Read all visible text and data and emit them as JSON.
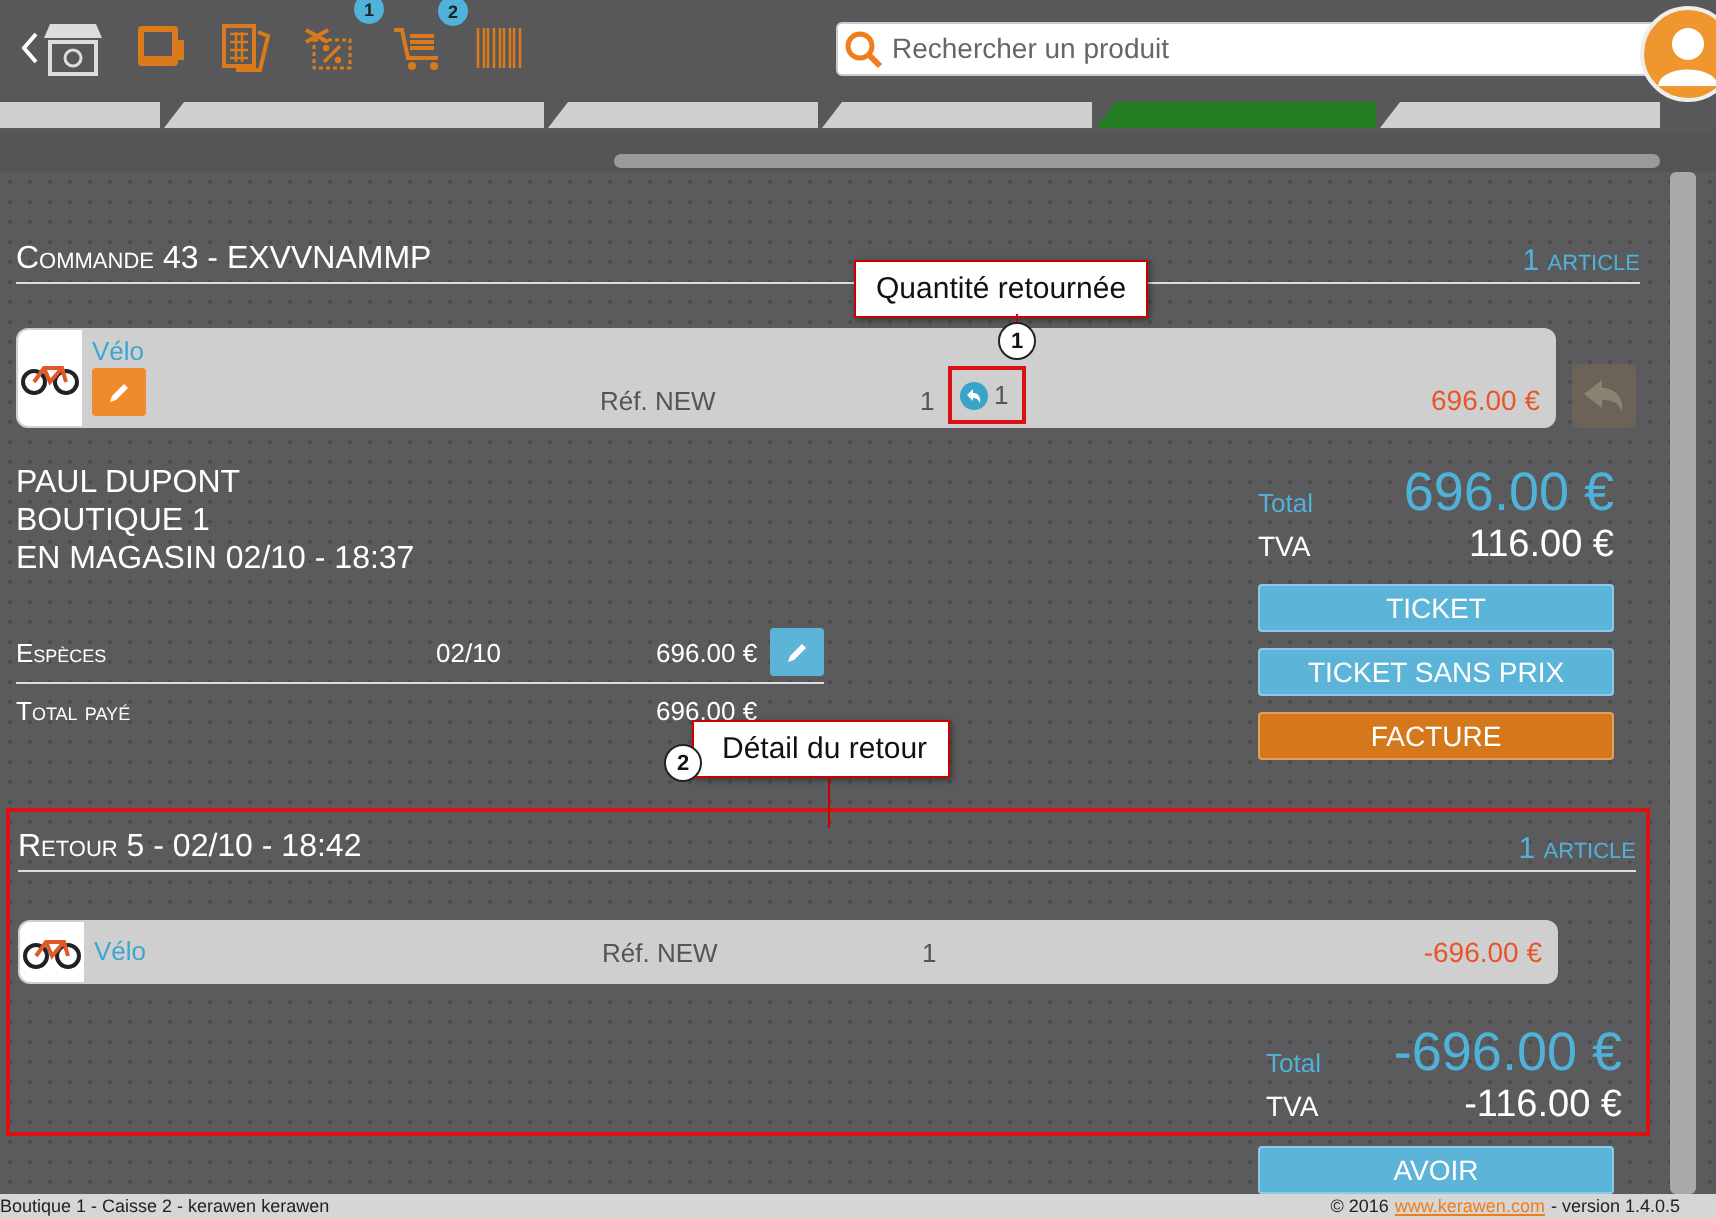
{
  "toolbar": [
    {
      "kind": "back-shop"
    },
    {
      "kind": "register"
    },
    {
      "kind": "catalog"
    },
    {
      "kind": "discount",
      "badge": "1"
    },
    {
      "kind": "cart",
      "badge": "2"
    },
    {
      "kind": "barcode"
    }
  ],
  "search": {
    "placeholder": "Rechercher un produit"
  },
  "steps": [
    {
      "selected": false
    },
    {
      "selected": false
    },
    {
      "selected": false
    },
    {
      "selected": false
    },
    {
      "selected": true
    },
    {
      "selected": false
    }
  ],
  "order": {
    "title": "Commande 43 - EXVVNAMMP",
    "count": "1",
    "count_label": "article",
    "line": {
      "name": "Vélo",
      "ref": "Réf. NEW",
      "qty": "1",
      "returned_qty": "1",
      "price": "696.00 €",
      "return_disabled": true
    },
    "customer": [
      "PAUL DUPONT",
      "BOUTIQUE 1",
      "EN MAGASIN 02/10 - 18:37"
    ],
    "payments": [
      {
        "label": "Espèces",
        "date": "02/10",
        "amount": "696.00 €"
      }
    ],
    "paid": {
      "label": "Total payé",
      "amount": "696.00 €"
    },
    "total_label": "Total",
    "total": "696.00 €",
    "tax_label": "TVA",
    "tax": "116.00 €",
    "buttons": [
      {
        "label": "TICKET",
        "kind": "primary"
      },
      {
        "label": "TICKET SANS PRIX",
        "kind": "primary"
      },
      {
        "label": "FACTURE",
        "kind": "accent"
      }
    ]
  },
  "return": {
    "title": "Retour 5 - 02/10 - 18:42",
    "count": "1",
    "count_label": "article",
    "line": {
      "name": "Vélo",
      "ref": "Réf. NEW",
      "qty": "1",
      "price": "-696.00 €"
    },
    "total_label": "Total",
    "total": "-696.00 €",
    "tax_label": "TVA",
    "tax": "-116.00 €",
    "buttons": [
      {
        "label": "AVOIR",
        "kind": "primary"
      }
    ]
  },
  "annotations": [
    {
      "number": "1",
      "label": "Quantité retournée"
    },
    {
      "number": "2",
      "label": "Détail du retour"
    }
  ],
  "footer": {
    "left": "Boutique 1 - Caisse 2 - kerawen kerawen",
    "copyright": "© 2016",
    "link": "www.kerawen.com",
    "version": "- version 1.4.0.5"
  }
}
